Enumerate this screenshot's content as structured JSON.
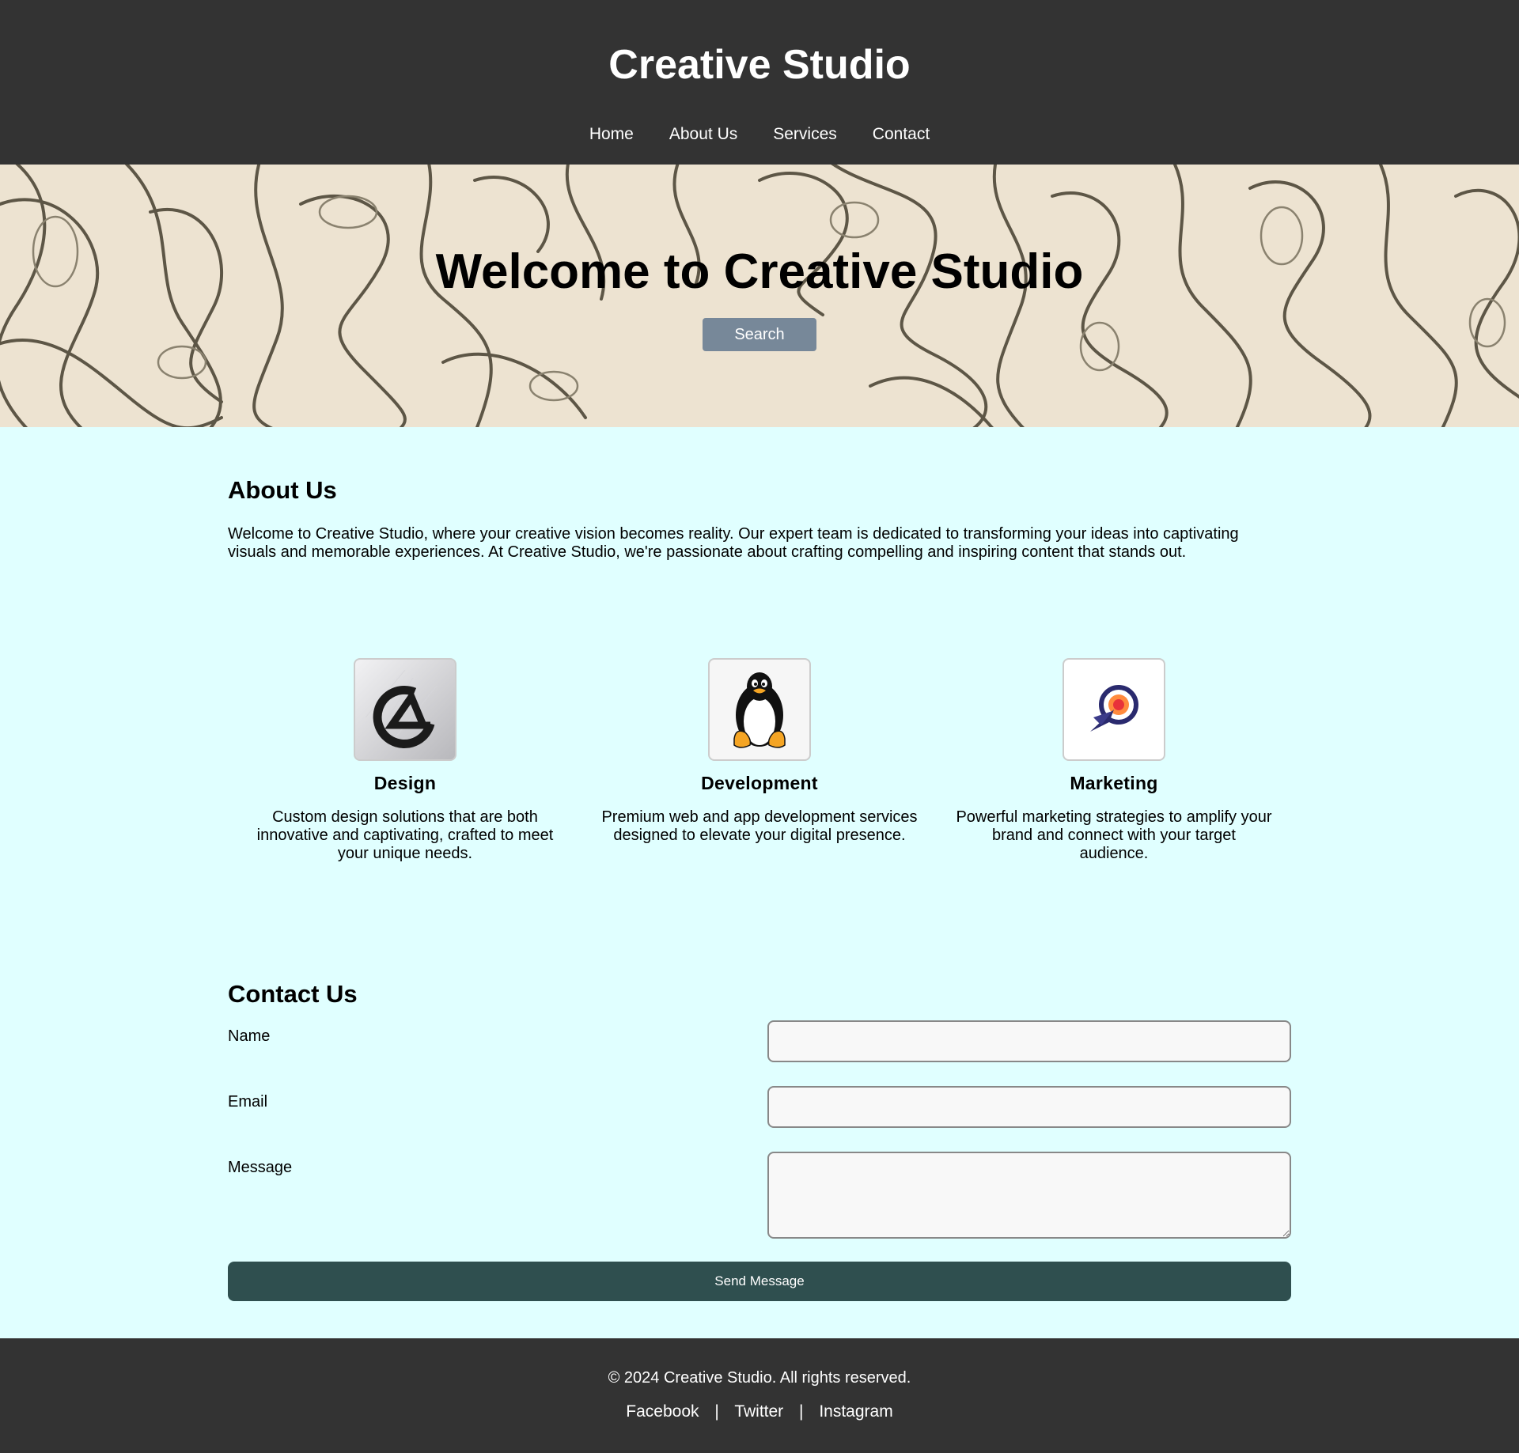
{
  "header": {
    "title": "Creative Studio",
    "nav": [
      "Home",
      "About Us",
      "Services",
      "Contact"
    ]
  },
  "hero": {
    "title": "Welcome to Creative Studio",
    "search_label": "Search"
  },
  "about": {
    "title": "About Us",
    "text": "Welcome to Creative Studio, where your creative vision becomes reality. Our expert team is dedicated to transforming your ideas into captivating visuals and memorable experiences. At Creative Studio, we're passionate about crafting compelling and inspiring content that stands out."
  },
  "services": [
    {
      "icon": "design-logo-icon",
      "title": "Design",
      "description": "Custom design solutions that are both innovative and captivating, crafted to meet your unique needs."
    },
    {
      "icon": "linux-penguin-icon",
      "title": "Development",
      "description": "Premium web and app development services designed to elevate your digital presence."
    },
    {
      "icon": "target-rocket-icon",
      "title": "Marketing",
      "description": "Powerful marketing strategies to amplify your brand and connect with your target audience."
    }
  ],
  "contact": {
    "title": "Contact Us",
    "labels": {
      "name": "Name",
      "email": "Email",
      "message": "Message"
    },
    "values": {
      "name": "",
      "email": "",
      "message": ""
    },
    "submit_label": "Send Message"
  },
  "footer": {
    "copyright": "© 2024 Creative Studio. All rights reserved.",
    "social": [
      "Facebook",
      "Twitter",
      "Instagram"
    ],
    "separator": "|"
  },
  "colors": {
    "header_bg": "#333333",
    "page_bg": "#e0ffff",
    "search_button": "#778899",
    "send_button": "#2f4f4f"
  }
}
